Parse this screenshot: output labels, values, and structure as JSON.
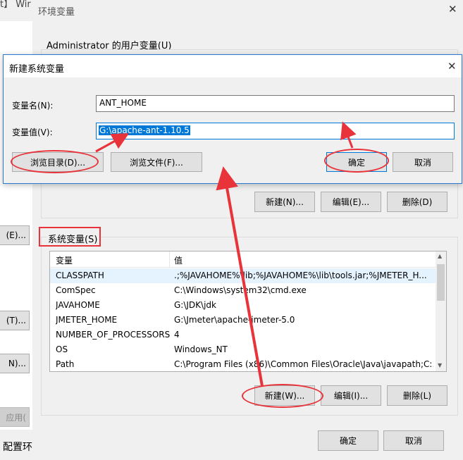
{
  "bg_window": {
    "title_fragment": "t】 Wir",
    "buttons": [
      "(E)...",
      "(T)...",
      "N)..."
    ],
    "apply_label": "应用(",
    "bottom_text": "配置环"
  },
  "env_dialog": {
    "title": "环境变量",
    "user_section_label": "Administrator 的用户变量(U)",
    "user_buttons": {
      "new": "新建(N)...",
      "edit": "编辑(E)...",
      "delete": "删除(D)"
    },
    "system_section_label": "系统变量(S)",
    "table": {
      "headers": [
        "变量",
        "值"
      ],
      "rows": [
        {
          "name": "CLASSPATH",
          "value": ".;%JAVAHOME%\\lib;%JAVAHOME%\\lib\\tools.jar;%JMETER_H..."
        },
        {
          "name": "ComSpec",
          "value": "C:\\Windows\\system32\\cmd.exe"
        },
        {
          "name": "JAVAHOME",
          "value": "G:\\JDK\\jdk"
        },
        {
          "name": "JMETER_HOME",
          "value": "G:\\Jmeter\\apache-jmeter-5.0"
        },
        {
          "name": "NUMBER_OF_PROCESSORS",
          "value": "4"
        },
        {
          "name": "OS",
          "value": "Windows_NT"
        },
        {
          "name": "Path",
          "value": "C:\\Program Files (x86)\\Common Files\\Oracle\\Java\\javapath;C:..."
        }
      ]
    },
    "system_buttons": {
      "new": "新建(W)...",
      "edit": "编辑(I)...",
      "delete": "删除(L)"
    },
    "ok": "确定",
    "cancel": "取消"
  },
  "new_var_dialog": {
    "title": "新建系统变量",
    "name_label": "变量名(N):",
    "name_value": "ANT_HOME",
    "value_label": "变量值(V):",
    "value_value": "G:\\apache-ant-1.10.5",
    "browse_dir": "浏览目录(D)...",
    "browse_file": "浏览文件(F)...",
    "ok": "确定",
    "cancel": "取消"
  },
  "colors": {
    "annotation": "#e8333a",
    "selection": "#0078d7"
  }
}
